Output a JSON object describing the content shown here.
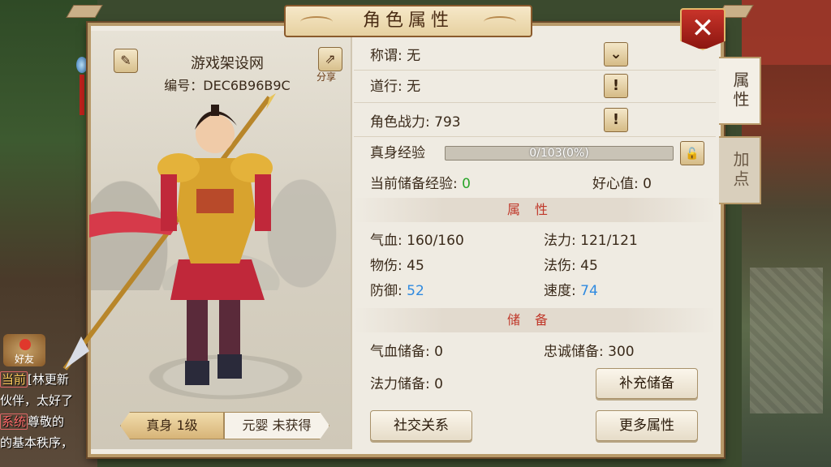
{
  "window": {
    "title": "角色属性",
    "close_icon": "✕"
  },
  "tabs": [
    {
      "label": "属性",
      "active": true
    },
    {
      "label": "加点",
      "active": false
    }
  ],
  "character": {
    "name": "游戏架设网",
    "id_label": "编号：DEC6B96B9C",
    "share_label": "分享",
    "forms": [
      {
        "label": "真身 1级",
        "active": true
      },
      {
        "label": "元婴 未获得",
        "active": false
      }
    ]
  },
  "info": {
    "title_label": "称谓: 无",
    "daohang_label": "道行: 无",
    "power_label": "角色战力: 793",
    "exp_label": "真身经验",
    "exp_text": "0/103(0%)",
    "exp_fraction": 0.0,
    "stored_exp_label": "当前储备经验: ",
    "stored_exp_value": "0",
    "goodwill": "好心值: 0"
  },
  "attributes": {
    "header": "属性",
    "hp": "气血: 160/160",
    "mp": "法力: 121/121",
    "phys_atk": "物伤: 45",
    "mag_atk": "法伤: 45",
    "defense_label": "防御: ",
    "defense_value": "52",
    "speed_label": "速度: ",
    "speed_value": "74"
  },
  "reserve": {
    "header": "储备",
    "hp_reserve": "气血储备: 0",
    "loyalty_reserve": "忠诚储备: 300",
    "mp_reserve": "法力储备: 0"
  },
  "buttons": {
    "refill": "补充储备",
    "social": "社交关系",
    "more_attrs": "更多属性",
    "dropdown_icon": "⌄",
    "info_icon": "!",
    "lock_icon": "🔓",
    "edit_icon": "✎",
    "share_icon": "⇗"
  },
  "chat": {
    "friend_label": "好友",
    "lines": [
      {
        "tag": "当前",
        "text": "[林更新"
      },
      {
        "tag": "",
        "text": "伙伴，太好了"
      },
      {
        "tag": "系统",
        "text": "尊敬的"
      },
      {
        "tag": "",
        "text": "的基本秩序，"
      }
    ]
  },
  "colors": {
    "accent_red": "#c0382a",
    "green_value": "#2aa52a",
    "blue_value": "#2f8ae0"
  }
}
